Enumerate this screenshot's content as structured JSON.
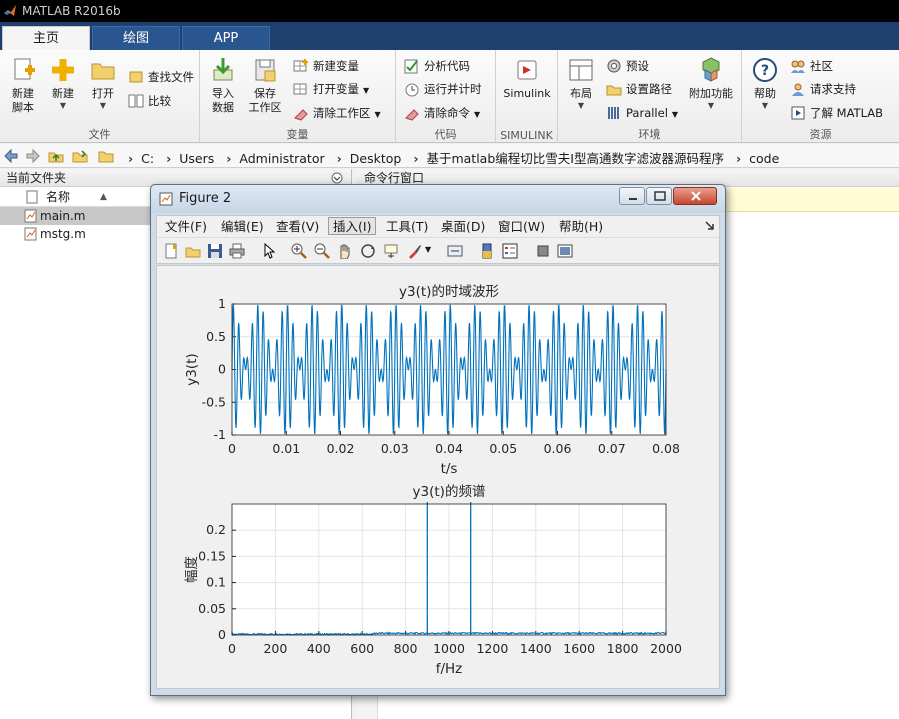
{
  "window": {
    "title": "MATLAB R2016b"
  },
  "tabs": [
    {
      "label": "主页",
      "active": true
    },
    {
      "label": "绘图",
      "active": false
    },
    {
      "label": "APP",
      "active": false
    }
  ],
  "ribbon": {
    "file_group": {
      "name": "文件",
      "new_script": "新建\n脚本",
      "new": "新建",
      "open": "打开",
      "find_files": "查找文件",
      "compare": "比较"
    },
    "variable_group": {
      "name": "变量",
      "import": "导入\n数据",
      "save_ws": "保存\n工作区",
      "new_var": "新建变量",
      "open_var": "打开变量",
      "clear_ws": "清除工作区"
    },
    "code_group": {
      "name": "代码",
      "analyze": "分析代码",
      "run_time": "运行并计时",
      "clear_cmd": "清除命令"
    },
    "simulink_group": {
      "name": "SIMULINK",
      "simulink": "Simulink"
    },
    "env_group": {
      "name": "环境",
      "layout": "布局",
      "prefs": "预设",
      "set_path": "设置路径",
      "parallel": "Parallel",
      "addons": "附加功能"
    },
    "resources_group": {
      "name": "资源",
      "help": "帮助",
      "community": "社区",
      "support": "请求支持",
      "learn": "了解 MATLAB"
    }
  },
  "address": {
    "crumbs": [
      "C:",
      "Users",
      "Administrator",
      "Desktop",
      "基于matlab编程切比雪夫I型高通数字滤波器源码程序",
      "code"
    ]
  },
  "folder_panel": {
    "title": "当前文件夹",
    "col_name": "名称",
    "sort_indicator": "▲",
    "files": [
      {
        "name": "main.m",
        "selected": true
      },
      {
        "name": "mstg.m",
        "selected": false
      }
    ]
  },
  "command_panel": {
    "title": "命令行窗口"
  },
  "figure": {
    "title": "Figure 2",
    "menus": [
      "文件(F)",
      "编辑(E)",
      "查看(V)",
      "插入(I)",
      "工具(T)",
      "桌面(D)",
      "窗口(W)",
      "帮助(H)"
    ],
    "highlighted_menu": "插入(I)"
  },
  "chart_data": [
    {
      "type": "line",
      "title": "y3(t)的时域波形",
      "xlabel": "t/s",
      "ylabel": "y3(t)",
      "xlim": [
        0,
        0.08
      ],
      "ylim": [
        -1,
        1
      ],
      "xticks": [
        "0",
        "0.01",
        "0.02",
        "0.03",
        "0.04",
        "0.05",
        "0.06",
        "0.07",
        "0.08"
      ],
      "yticks": [
        "-1",
        "-0.5",
        "0",
        "0.5",
        "1"
      ],
      "grid": true,
      "series": [
        {
          "color": "#0072bd",
          "components_hz": [
            900,
            1100
          ],
          "amplitudes": [
            0.5,
            0.5
          ]
        }
      ]
    },
    {
      "type": "line",
      "title": "y3(t)的频谱",
      "xlabel": "f/Hz",
      "ylabel": "幅度",
      "xlim": [
        0,
        2000
      ],
      "ylim": [
        0,
        0.25
      ],
      "xticks": [
        "0",
        "200",
        "400",
        "600",
        "800",
        "1000",
        "1200",
        "1400",
        "1600",
        "1800",
        "2000"
      ],
      "yticks": [
        "0",
        "0.05",
        "0.1",
        "0.15",
        "0.2"
      ],
      "grid": true,
      "peaks": [
        {
          "f": 900,
          "amplitude": 0.25
        },
        {
          "f": 1100,
          "amplitude": 0.25
        }
      ],
      "noise_floor": 0.003,
      "series": [
        {
          "color": "#0072bd"
        }
      ]
    }
  ],
  "colors": {
    "accent": "#0072bd",
    "tab_bar": "#1f3f6e",
    "selected_row": "#c8c8c8"
  }
}
